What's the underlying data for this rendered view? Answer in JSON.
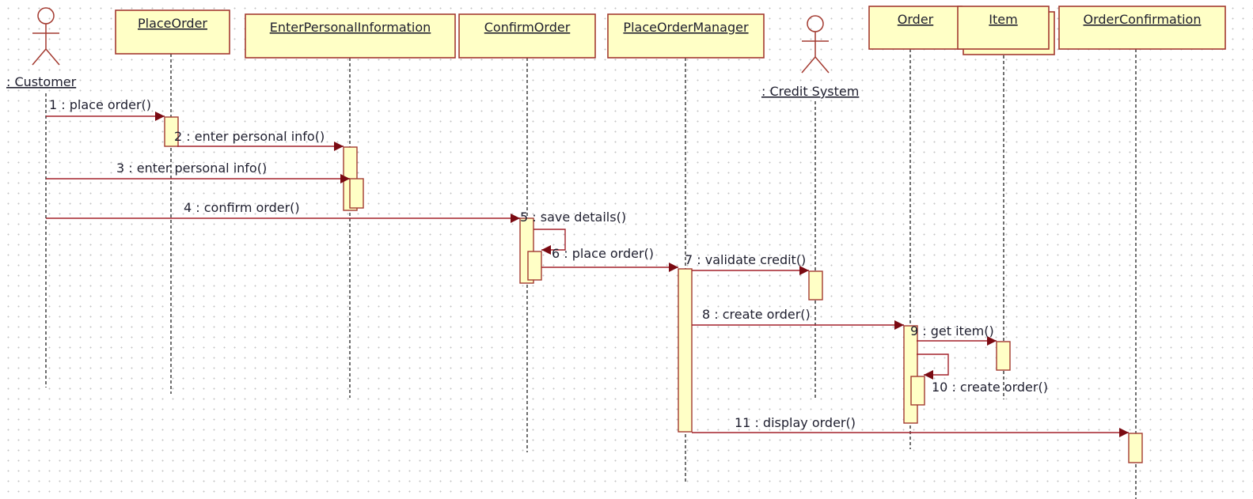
{
  "diagram_type": "UML sequence diagram",
  "colors": {
    "object_fill": "#ffffc6",
    "object_border": "#a33a30",
    "message_line": "#a3212a",
    "arrowhead": "#7a0a12"
  },
  "actors": [
    {
      "id": "customer",
      "label": ": Customer"
    },
    {
      "id": "credit",
      "label": ": Credit System"
    }
  ],
  "objects": [
    {
      "id": "placeorder",
      "label": "PlaceOrder"
    },
    {
      "id": "epi",
      "label": "EnterPersonalInformation"
    },
    {
      "id": "confirm",
      "label": "ConfirmOrder"
    },
    {
      "id": "pom",
      "label": "PlaceOrderManager"
    },
    {
      "id": "order",
      "label": "Order"
    },
    {
      "id": "item",
      "label": "Item",
      "multi": true
    },
    {
      "id": "oc",
      "label": "OrderConfirmation"
    }
  ],
  "messages": [
    {
      "from": "customer",
      "to": "placeorder",
      "label": "1 : place order()"
    },
    {
      "from": "placeorder",
      "to": "epi",
      "label": "2 : enter personal info()"
    },
    {
      "from": "customer",
      "to": "epi",
      "label": "3 : enter personal info()"
    },
    {
      "from": "customer",
      "to": "confirm",
      "label": "4 : confirm order()"
    },
    {
      "from": "confirm",
      "to": "confirm",
      "label": "5 : save details()"
    },
    {
      "from": "confirm",
      "to": "pom",
      "label": "6 : place order()"
    },
    {
      "from": "pom",
      "to": "credit",
      "label": "7 : validate credit()"
    },
    {
      "from": "pom",
      "to": "order",
      "label": "8 : create order()"
    },
    {
      "from": "order",
      "to": "item",
      "label": "9 : get item()"
    },
    {
      "from": "order",
      "to": "order",
      "label": "10 : create order()"
    },
    {
      "from": "pom",
      "to": "oc",
      "label": "11 : display order()"
    }
  ]
}
